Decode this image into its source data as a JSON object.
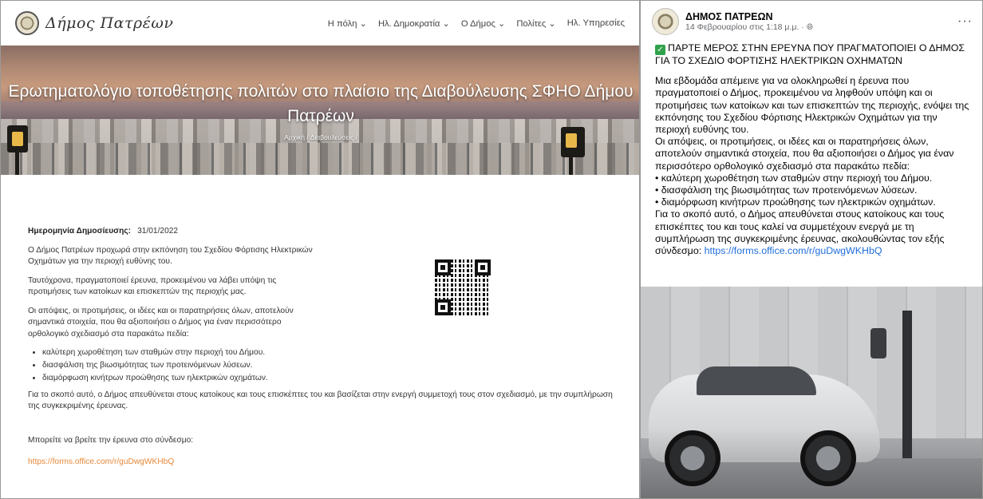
{
  "site": {
    "logo_text": "Δήμος Πατρέων",
    "nav": [
      {
        "label": "Η πόλη",
        "caret": "⌄"
      },
      {
        "label": "Ηλ. Δημοκρατία",
        "caret": "⌄"
      },
      {
        "label": "Ο Δήμος",
        "caret": "⌄"
      },
      {
        "label": "Πολίτες",
        "caret": "⌄"
      },
      {
        "label": "Ηλ. Υπηρεσίες",
        "caret": ""
      }
    ],
    "hero_title": "Ερωτηματολόγιο τοποθέτησης πολιτών στο πλαίσιο της Διαβούλευσης ΣΦΗΟ Δήμου Πατρέων",
    "breadcrumb": {
      "home": "Αρχική",
      "sep": "/",
      "section": "Διαβουλεύσεις",
      "sep2": "/"
    },
    "date_label": "Ημερομηνία Δημοσίευσης:",
    "date_value": "31/01/2022",
    "paragraphs": [
      "Ο Δήμος Πατρέων προχωρά στην εκπόνηση του Σχεδίου Φόρτισης Ηλεκτρικών Οχημάτων για την περιοχή ευθύνης του.",
      "Ταυτόχρονα, πραγματοποιεί έρευνα, προκειμένου να λάβει υπόψη τις προτιμήσεις των κατοίκων και επισκεπτών της περιοχής μας.",
      "Οι απόψεις, οι προτιμήσεις, οι ιδέες και οι παρατηρήσεις όλων, αποτελούν σημαντικά στοιχεία, που θα αξιοποιήσει ο Δήμος για έναν περισσότερο ορθολογικό σχεδιασμό στα παρακάτω πεδία:"
    ],
    "bullets": [
      "καλύτερη χωροθέτηση των σταθμών στην περιοχή του Δήμου.",
      "διασφάλιση της βιωσιμότητας των προτεινόμενων λύσεων.",
      "διαμόρφωση κινήτρων προώθησης των ηλεκτρικών οχημάτων."
    ],
    "closing": "Για το σκοπό αυτό, ο Δήμος απευθύνεται στους κατοίκους και τους επισκέπτες του και βασίζεται στην ενεργή συμμετοχή τους στον σχεδιασμό, με την συμπλήρωση της συγκεκριμένης έρευνας.",
    "find_survey": "Μπορείτε να βρείτε την έρευνα στο σύνδεσμο:",
    "survey_link": "https://forms.office.com/r/guDwgWKHbQ",
    "accent_color": "#e7883a"
  },
  "facebook_post": {
    "page_name": "ΔΗΜΟΣ ΠΑΤΡΕΩΝ",
    "timestamp": "14 Φεβρουαρίου στις 1:18 μ.μ. · ",
    "audience_icon": "globe-icon",
    "more_label": "···",
    "headline": "ΠΑΡΤΕ ΜΕΡΟΣ ΣΤΗΝ ΕΡΕΥΝΑ ΠΟΥ ΠΡΑΓΜΑΤΟΠΟΙΕΙ Ο ΔΗΜΟΣ ΓΙΑ ΤΟ ΣΧΕΔΙΟ ΦΟΡΤΙΣΗΣ ΗΛΕΚΤΡΙΚΩΝ ΟΧΗΜΑΤΩΝ",
    "body_1": "Μια εβδομάδα απέμεινε για να ολοκληρωθεί η έρευνα που πραγματοποιεί ο Δήμος, προκειμένου να ληφθούν υπόψη και οι προτιμήσεις των κατοίκων και των επισκεπτών της περιοχής, ενόψει της εκπόνησης του Σχεδίου Φόρτισης Ηλεκτρικών Οχημάτων για την περιοχή ευθύνης του.",
    "body_2": "Οι απόψεις, οι προτιμήσεις, οι ιδέες και οι παρατηρήσεις όλων, αποτελούν σημαντικά στοιχεία, που θα αξιοποιήσει ο Δήμος για έναν περισσότερο ορθολογικό σχεδιασμό στα παρακάτω πεδία:",
    "bullets": [
      "• καλύτερη χωροθέτηση των σταθμών στην περιοχή του Δήμου.",
      "• διασφάλιση της βιωσιμότητας των προτεινόμενων λύσεων.",
      "• διαμόρφωση κινήτρων προώθησης των ηλεκτρικών οχημάτων."
    ],
    "body_3": "Για το σκοπό αυτό, ο Δήμος απευθύνεται στους κατοίκους και τους επισκέπτες του και τους καλεί να συμμετέχουν ενεργά με τη συμπλήρωση της συγκεκριμένης έρευνας, ακολουθώντας τον εξής σύνδεσμο: ",
    "link": "https://forms.office.com/r/guDwgWKHbQ",
    "link_color": "#216fdb"
  }
}
